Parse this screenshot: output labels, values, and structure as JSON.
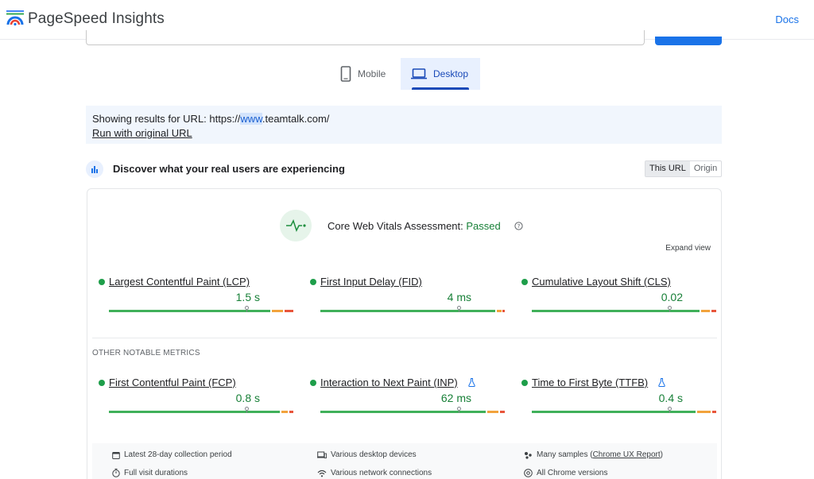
{
  "header": {
    "brand": "PageSpeed Insights",
    "docs_label": "Docs"
  },
  "tabs": [
    {
      "label": "Mobile",
      "icon": "phone-icon",
      "selected": false
    },
    {
      "label": "Desktop",
      "icon": "laptop-icon",
      "selected": true
    }
  ],
  "notice": {
    "prefix": "Showing results for URL: https://",
    "highlight": "www",
    "suffix": ".teamtalk.com/",
    "link": "Run with original URL"
  },
  "field": {
    "title": "Discover what your real users are experiencing",
    "toggle": [
      "This URL",
      "Origin"
    ],
    "toggle_active": "This URL"
  },
  "assessment": {
    "label": "Core Web Vitals Assessment: ",
    "status": "Passed",
    "expand_label": "Expand view"
  },
  "core_metrics": [
    {
      "name": "Largest Contentful Paint (LCP)",
      "value": "1.5 s",
      "experimental": false
    },
    {
      "name": "First Input Delay (FID)",
      "value": "4 ms",
      "experimental": false
    },
    {
      "name": "Cumulative Layout Shift (CLS)",
      "value": "0.02",
      "experimental": false
    }
  ],
  "other_heading": "OTHER NOTABLE METRICS",
  "other_metrics": [
    {
      "name": "First Contentful Paint (FCP)",
      "value": "0.8 s",
      "experimental": false
    },
    {
      "name": "Interaction to Next Paint (INP)",
      "value": "62 ms",
      "experimental": true
    },
    {
      "name": "Time to First Byte (TTFB)",
      "value": "0.4 s",
      "experimental": true
    }
  ],
  "info": {
    "period": "Latest 28-day collection period",
    "devices": "Various desktop devices",
    "samples_prefix": "Many samples (",
    "samples_link": "Chrome UX Report",
    "samples_suffix": ")",
    "durations": "Full visit durations",
    "network": "Various network connections",
    "versions": "All Chrome versions"
  },
  "colors": {
    "accent": "#1a73e8",
    "good": "#188038",
    "needs_improvement": "#f2a33c",
    "poor": "#e8553b"
  }
}
